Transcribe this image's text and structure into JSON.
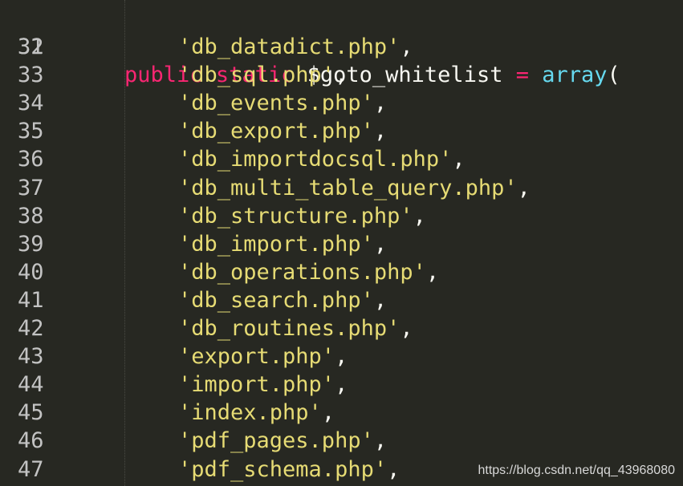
{
  "editor": {
    "header_line": {
      "number": "31",
      "keyword1": "public",
      "keyword2": "static",
      "variable": "$goto_whitelist",
      "operator": "=",
      "function": "array",
      "paren": "("
    },
    "lines": [
      {
        "number": "32",
        "string": "'db_datadict.php'",
        "punc": ","
      },
      {
        "number": "33",
        "string": "'db_sql.php'",
        "punc": ","
      },
      {
        "number": "34",
        "string": "'db_events.php'",
        "punc": ","
      },
      {
        "number": "35",
        "string": "'db_export.php'",
        "punc": ","
      },
      {
        "number": "36",
        "string": "'db_importdocsql.php'",
        "punc": ","
      },
      {
        "number": "37",
        "string": "'db_multi_table_query.php'",
        "punc": ","
      },
      {
        "number": "38",
        "string": "'db_structure.php'",
        "punc": ","
      },
      {
        "number": "39",
        "string": "'db_import.php'",
        "punc": ","
      },
      {
        "number": "40",
        "string": "'db_operations.php'",
        "punc": ","
      },
      {
        "number": "41",
        "string": "'db_search.php'",
        "punc": ","
      },
      {
        "number": "42",
        "string": "'db_routines.php'",
        "punc": ","
      },
      {
        "number": "43",
        "string": "'export.php'",
        "punc": ","
      },
      {
        "number": "44",
        "string": "'import.php'",
        "punc": ","
      },
      {
        "number": "45",
        "string": "'index.php'",
        "punc": ","
      },
      {
        "number": "46",
        "string": "'pdf_pages.php'",
        "punc": ","
      },
      {
        "number": "47",
        "string": "'pdf_schema.php'",
        "punc": ","
      }
    ]
  },
  "watermark": "https://blog.csdn.net/qq_43968080",
  "colors": {
    "background": "#272822",
    "keyword": "#f92672",
    "function": "#66d9ef",
    "string": "#e6db74",
    "line_number": "#c3c3c3"
  }
}
